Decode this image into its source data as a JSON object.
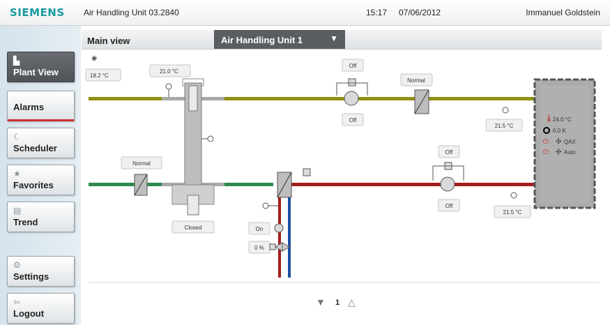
{
  "header": {
    "brand": "SIEMENS",
    "title": "Air Handling Unit 03.2840",
    "time": "15:17",
    "date": "07/06/2012",
    "user": "Immanuel Goldstein"
  },
  "nav": [
    {
      "label": "Plant View",
      "icon": "plant-icon",
      "active": true
    },
    {
      "label": "Alarms",
      "icon": "",
      "active": false
    },
    {
      "label": "Scheduler",
      "icon": "moon-icon",
      "active": false
    },
    {
      "label": "Favorites",
      "icon": "star-icon",
      "active": false
    },
    {
      "label": "Trend",
      "icon": "chart-icon",
      "active": false
    },
    {
      "label": "Settings",
      "icon": "gear-icon",
      "active": false
    },
    {
      "label": "Logout",
      "icon": "logout-icon",
      "active": false
    }
  ],
  "viewbar": {
    "label": "Main view",
    "selected": "Air Handling Unit 1"
  },
  "diagram": {
    "outside_temp": "18.2 °C",
    "preheat_temp": "21.0 °C",
    "fan_top_state_a": "Off",
    "fan_top_state_b": "Off",
    "filter_top_state": "Normal",
    "supply_temp_top": "21.5 °C",
    "filter_bottom_state": "Normal",
    "damper_state": "Closed",
    "pump_state": "On",
    "valve_position": "0 %",
    "fan_bottom_state_a": "Off",
    "fan_bottom_state_b": "Off",
    "return_temp": "21.5 °C",
    "room": {
      "temp": "24.0 °C",
      "delta": "0.0 K",
      "mode1": "QAX",
      "mode2": "Auto"
    }
  },
  "pager": {
    "page": "1"
  },
  "colors": {
    "brand": "#169b9f",
    "supply_duct": "#8f8f13",
    "outside_duct": "#2e8a4d",
    "return_duct": "#a51e1e",
    "water_flow": "#1d4f9e",
    "alarm_accent": "#d0302e"
  }
}
